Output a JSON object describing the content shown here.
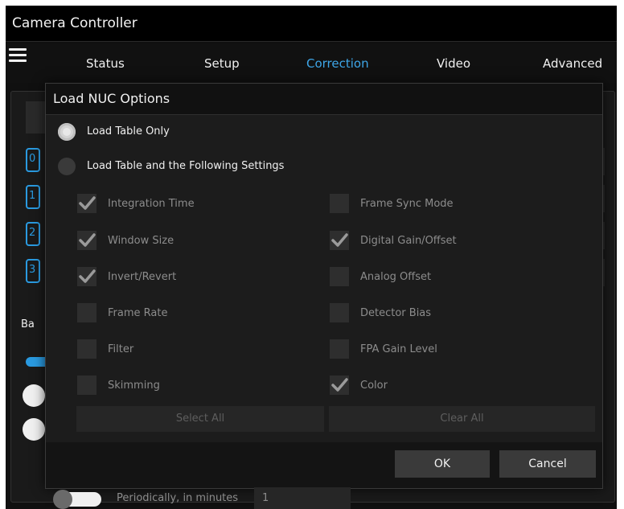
{
  "app": {
    "title": "Camera Controller"
  },
  "nav": {
    "tabs": [
      {
        "label": "Status",
        "active": false
      },
      {
        "label": "Setup",
        "active": false
      },
      {
        "label": "Correction",
        "active": true
      },
      {
        "label": "Video",
        "active": false
      },
      {
        "label": "Advanced",
        "active": false
      }
    ]
  },
  "background": {
    "blue_items": [
      "0",
      "1",
      "2",
      "3"
    ],
    "side_label": "Ba",
    "periodic_label": "Periodically, in minutes",
    "periodic_value": "1"
  },
  "dialog": {
    "title": "Load NUC Options",
    "radios": [
      {
        "label": "Load Table Only",
        "selected": true
      },
      {
        "label": "Load Table and the Following Settings",
        "selected": false
      }
    ],
    "checkboxes_left": [
      {
        "label": "Integration Time",
        "checked": true
      },
      {
        "label": "Window Size",
        "checked": true
      },
      {
        "label": "Invert/Revert",
        "checked": true
      },
      {
        "label": "Frame Rate",
        "checked": false
      },
      {
        "label": "Filter",
        "checked": false
      },
      {
        "label": "Skimming",
        "checked": false
      }
    ],
    "checkboxes_right": [
      {
        "label": "Frame Sync Mode",
        "checked": false
      },
      {
        "label": "Digital Gain/Offset",
        "checked": true
      },
      {
        "label": "Analog Offset",
        "checked": false
      },
      {
        "label": "Detector Bias",
        "checked": false
      },
      {
        "label": "FPA Gain Level",
        "checked": false
      },
      {
        "label": "Color",
        "checked": true
      }
    ],
    "select_all_label": "Select All",
    "clear_all_label": "Clear All",
    "ok_label": "OK",
    "cancel_label": "Cancel"
  },
  "colors": {
    "accent": "#3ea6e8",
    "background": "#101010",
    "dialog": "#1c1c1c"
  }
}
